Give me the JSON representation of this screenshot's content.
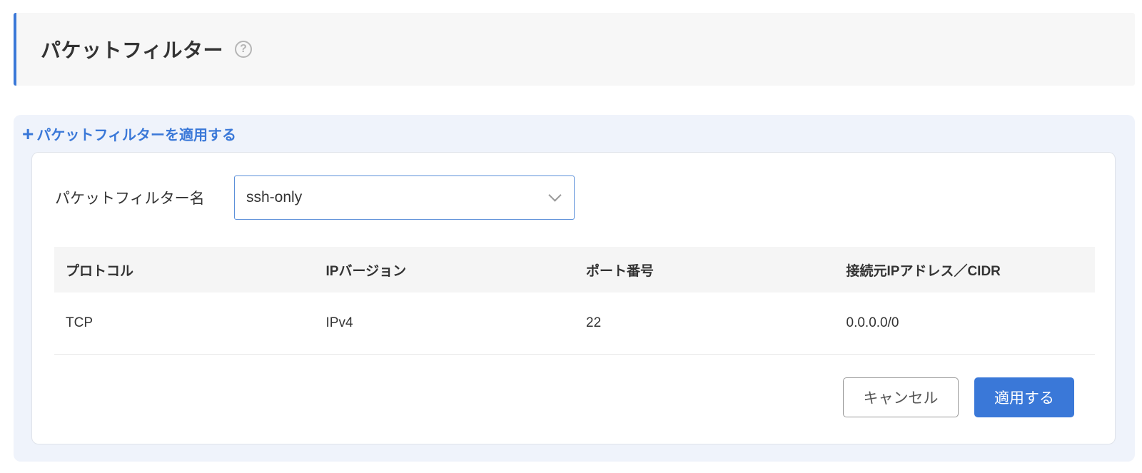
{
  "header": {
    "title": "パケットフィルター",
    "help_icon": "?"
  },
  "panel": {
    "apply_link_icon": "+",
    "apply_link_label": "パケットフィルターを適用する"
  },
  "form": {
    "filter_name_label": "パケットフィルター名",
    "filter_name_value": "ssh-only"
  },
  "table": {
    "headers": [
      "プロトコル",
      "IPバージョン",
      "ポート番号",
      "接続元IPアドレス／CIDR"
    ],
    "rows": [
      [
        "TCP",
        "IPv4",
        "22",
        "0.0.0.0/0"
      ]
    ]
  },
  "actions": {
    "cancel_label": "キャンセル",
    "apply_label": "適用する"
  },
  "colors": {
    "accent": "#3a78d8",
    "panel_bg": "#eff3fb",
    "header_bg": "#f7f7f7"
  }
}
